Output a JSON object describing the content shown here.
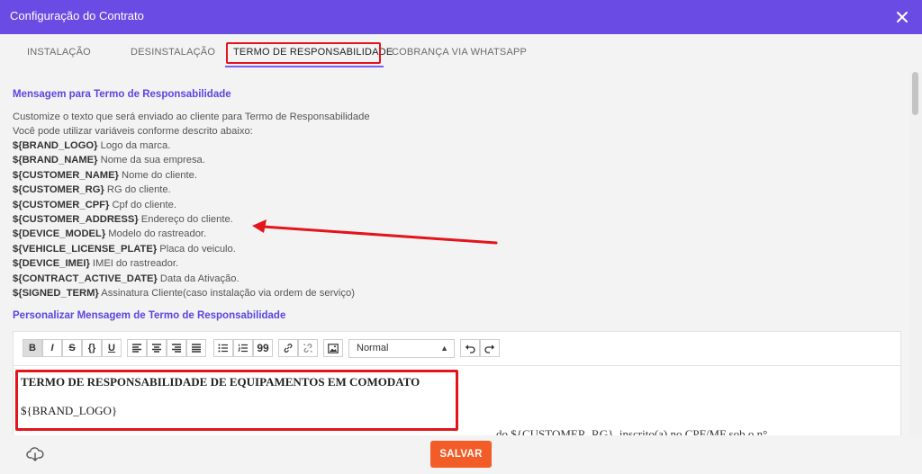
{
  "window": {
    "title": "Configuração do Contrato"
  },
  "tabs": [
    {
      "label": "INSTALAÇÃO"
    },
    {
      "label": "DESINSTALAÇÃO"
    },
    {
      "label": "TERMO DE RESPONSABILIDADE"
    },
    {
      "label": "COBRANÇA VIA WHATSAPP"
    }
  ],
  "section1": {
    "title": "Mensagem para Termo de Responsabilidade",
    "intro1": "Customize o texto que será enviado ao cliente para Termo de Responsabilidade",
    "intro2": "Você pode utilizar variáveis conforme descrito abaixo:",
    "variables": [
      {
        "key": "${BRAND_LOGO}",
        "desc": " Logo da marca."
      },
      {
        "key": "${BRAND_NAME}",
        "desc": " Nome da sua empresa."
      },
      {
        "key": "${CUSTOMER_NAME}",
        "desc": " Nome do cliente."
      },
      {
        "key": "${CUSTOMER_RG}",
        "desc": " RG do cliente."
      },
      {
        "key": "${CUSTOMER_CPF}",
        "desc": " Cpf do cliente."
      },
      {
        "key": "${CUSTOMER_ADDRESS}",
        "desc": " Endereço do cliente."
      },
      {
        "key": "${DEVICE_MODEL}",
        "desc": " Modelo do rastreador."
      },
      {
        "key": "${VEHICLE_LICENSE_PLATE}",
        "desc": " Placa do veiculo."
      },
      {
        "key": "${DEVICE_IMEI}",
        "desc": " IMEI do rastreador."
      },
      {
        "key": "${CONTRACT_ACTIVE_DATE}",
        "desc": " Data da Ativação."
      },
      {
        "key": "${SIGNED_TERM}",
        "desc": " Assinatura Cliente(caso instalação via ordem de serviço)"
      }
    ]
  },
  "section2": {
    "title": "Personalizar Mensagem de Termo de Responsabilidade"
  },
  "editor": {
    "toolbar": {
      "bold": "B",
      "italic": "I",
      "strike": "S",
      "code": "{}",
      "underline": "U",
      "quote": "99",
      "format_value": "Normal"
    },
    "content": {
      "title": "TERMO DE RESPONSABILIDADE DE EQUIPAMENTOS EM COMODATO",
      "logo": "${BRAND_LOGO}",
      "partial": "... do ${CUSTOMER_RG}, inscrito(a) no CPF/MF sob o n°"
    }
  },
  "footer": {
    "save_label": "SALVAR"
  },
  "colors": {
    "accent": "#6a4be3",
    "save": "#f25c26",
    "highlight": "#e3141c"
  }
}
